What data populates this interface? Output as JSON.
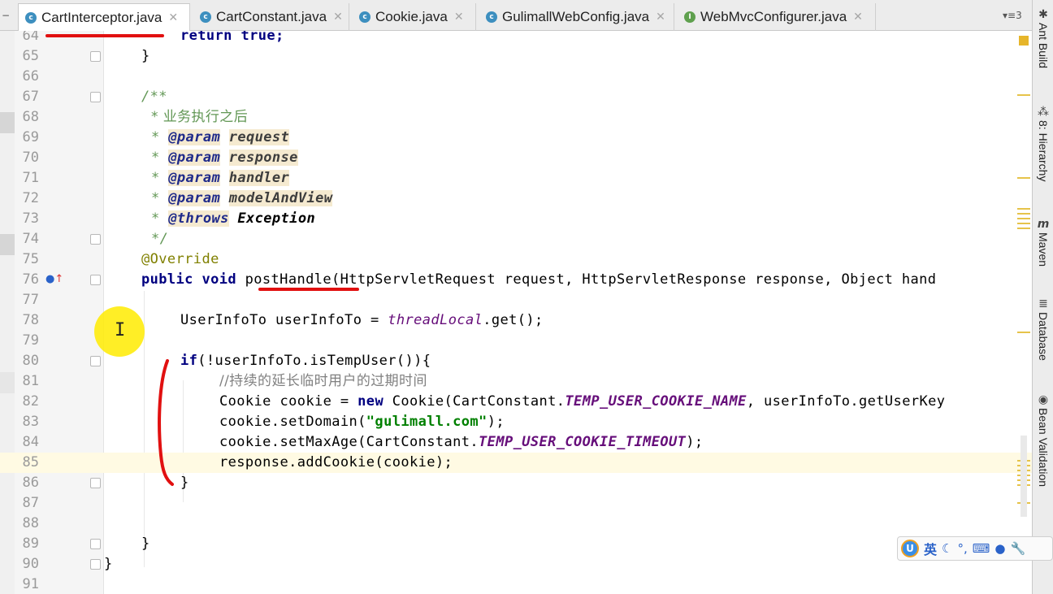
{
  "tabs": [
    {
      "label": "CartInterceptor.java",
      "icon": "class-icon",
      "active": true
    },
    {
      "label": "CartConstant.java",
      "icon": "class-icon",
      "active": false
    },
    {
      "label": "Cookie.java",
      "icon": "class-icon",
      "active": false
    },
    {
      "label": "GulimallWebConfig.java",
      "icon": "class-icon",
      "active": false
    },
    {
      "label": "WebMvcConfigurer.java",
      "icon": "interface-icon",
      "active": false
    }
  ],
  "tab_close": "✕",
  "tab_overflow": "▾≡3",
  "line_numbers": [
    "64",
    "65",
    "66",
    "67",
    "68",
    "69",
    "70",
    "71",
    "72",
    "73",
    "74",
    "75",
    "76",
    "77",
    "78",
    "79",
    "80",
    "81",
    "82",
    "83",
    "84",
    "85",
    "86",
    "87",
    "88",
    "89",
    "90",
    "91"
  ],
  "code": {
    "l64": "return true;",
    "l65": "}",
    "l67": "/**",
    "l68": "* 业务执行之后",
    "l69_tag": "@param",
    "l69_arg": "request",
    "l70_tag": "@param",
    "l70_arg": "response",
    "l71_tag": "@param",
    "l71_arg": "handler",
    "l72_tag": "@param",
    "l72_arg": "modelAndView",
    "l73_tag": "@throws",
    "l73_arg": "Exception",
    "l74": "*/",
    "l75": "@Override",
    "l76_kw1": "public",
    "l76_kw2": "void",
    "l76_name": "postHandle",
    "l76_rest": "(HttpServletRequest request, HttpServletResponse response, Object hand",
    "l78_a": "UserInfoTo userInfoTo = ",
    "l78_field": "threadLocal",
    "l78_b": ".get();",
    "l80_kw": "if",
    "l80_rest": "(!userInfoTo.isTempUser()){",
    "l81": "//持续的延长临时用户的过期时间",
    "l82_a": "Cookie cookie = ",
    "l82_kw": "new",
    "l82_b": " Cookie(CartConstant.",
    "l82_const": "TEMP_USER_COOKIE_NAME",
    "l82_c": ", userInfoTo.getUserKey",
    "l83_a": "cookie.setDomain(",
    "l83_str": "\"gulimall.com\"",
    "l83_b": ");",
    "l84_a": "cookie.setMaxAge(CartConstant.",
    "l84_const": "TEMP_USER_COOKIE_TIMEOUT",
    "l84_b": ");",
    "l85": "response.addCookie(cookie);",
    "l86": "}",
    "l89": "}",
    "l90": "}"
  },
  "tool_windows": [
    {
      "label": "Ant Build",
      "icon": "ant-icon"
    },
    {
      "label": "8: Hierarchy",
      "icon": "hierarchy-icon"
    },
    {
      "label": "Maven",
      "icon": "maven-icon"
    },
    {
      "label": "Database",
      "icon": "database-icon"
    },
    {
      "label": "Bean Validation",
      "icon": "bean-validation-icon"
    }
  ],
  "ime": {
    "mode": "英"
  },
  "colors": {
    "keyword": "#000080",
    "doc_comment": "#629755",
    "annotation": "#808000",
    "string": "#008000",
    "field": "#660e7a",
    "marker": "#e11010"
  }
}
